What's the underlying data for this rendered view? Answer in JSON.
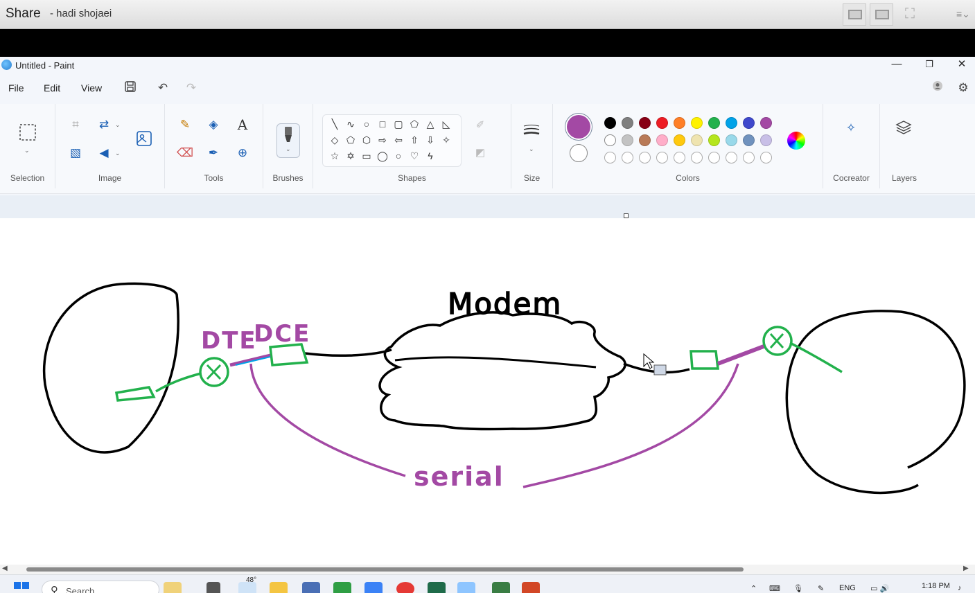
{
  "share": {
    "title": "Share",
    "user": "- hadi shojaei"
  },
  "window": {
    "title": "Untitled - Paint",
    "minimize": "—",
    "maximize": "❐",
    "close": "✕"
  },
  "menu": {
    "file": "File",
    "edit": "Edit",
    "view": "View"
  },
  "ribbon": {
    "groups": {
      "selection": "Selection",
      "image": "Image",
      "tools": "Tools",
      "brushes": "Brushes",
      "shapes": "Shapes",
      "size": "Size",
      "colors": "Colors",
      "cocreator": "Cocreator",
      "layers": "Layers"
    },
    "text_tool": "A"
  },
  "colors": {
    "primary": "#a349a4",
    "secondary": "#ffffff",
    "row1": [
      "#000000",
      "#7f7f7f",
      "#880015",
      "#ed1c24",
      "#ff7f27",
      "#fff200",
      "#22b14c",
      "#00a2e8",
      "#3f48cc",
      "#a349a4"
    ],
    "row2": [
      "#ffffff",
      "#c3c3c3",
      "#b97a57",
      "#ffaec9",
      "#ffc90e",
      "#efe4b0",
      "#b5e61d",
      "#99d9ea",
      "#7092be",
      "#c8bfe7"
    ]
  },
  "drawing": {
    "labels": {
      "modem": "Modem",
      "dte": "DTE",
      "dce": "DCE",
      "serial": "serial"
    },
    "ink_colors": {
      "black": "#000000",
      "green": "#22b14c",
      "purple": "#a349a4",
      "blue": "#00a2e8"
    }
  },
  "taskbar": {
    "search_placeholder": "Search",
    "weather": "48°",
    "language": "ENG",
    "time": "1:18 PM"
  }
}
